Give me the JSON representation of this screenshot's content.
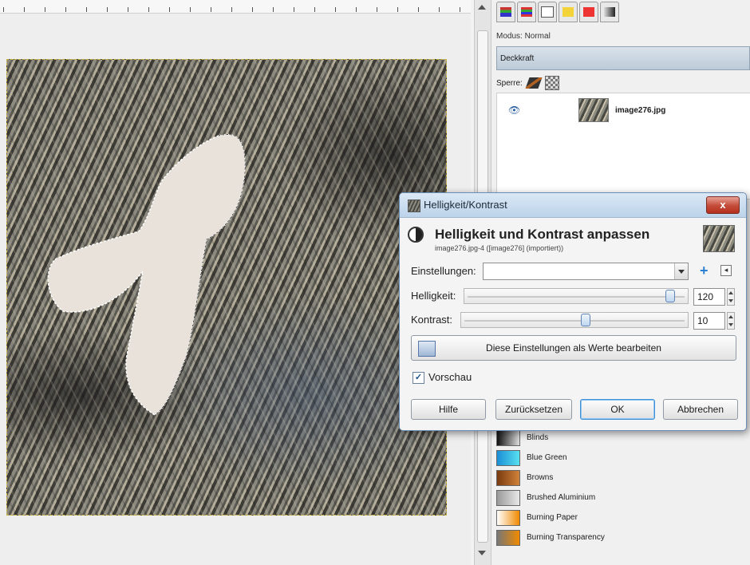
{
  "layers_panel": {
    "mode_label": "Modus: Normal",
    "opacity_label": "Deckkraft",
    "lock_label": "Sperre:",
    "layers": [
      {
        "name": "image276.jpg",
        "visible": true
      }
    ]
  },
  "gradients": [
    {
      "name": "Blinds",
      "colors": [
        "#111111",
        "#dddddd"
      ]
    },
    {
      "name": "Blue Green",
      "colors": [
        "#1a8ed6",
        "#58e0f0"
      ]
    },
    {
      "name": "Browns",
      "colors": [
        "#7a3a10",
        "#d1823a"
      ]
    },
    {
      "name": "Brushed Aluminium",
      "colors": [
        "#9a9a9a",
        "#e8e8e8"
      ]
    },
    {
      "name": "Burning Paper",
      "colors": [
        "#ffffff",
        "#f08a00"
      ]
    },
    {
      "name": "Burning Transparency",
      "colors": [
        "#777777",
        "#f08a00"
      ]
    }
  ],
  "dialog": {
    "window_title": "Helligkeit/Kontrast",
    "close_symbol": "x",
    "heading": "Helligkeit und Kontrast anpassen",
    "subheading": "image276.jpg-4 ([image276] (importiert))",
    "settings": {
      "label": "Einstellungen:",
      "value": "",
      "add_symbol": "+",
      "menu_symbol": "◂"
    },
    "brightness": {
      "label": "Helligkeit:",
      "value": "120",
      "fraction": 0.92
    },
    "contrast": {
      "label": "Kontrast:",
      "value": "10",
      "fraction": 0.55
    },
    "edit_as_values_label": "Diese Einstellungen als Werte bearbeiten",
    "preview": {
      "label": "Vorschau",
      "checked": true,
      "check_symbol": "✓"
    },
    "buttons": {
      "help": "Hilfe",
      "reset": "Zurücksetzen",
      "ok": "OK",
      "cancel": "Abbrechen"
    }
  },
  "colors": {
    "selection_marquee": "#ffffff",
    "accent_blue": "#3d8fd6",
    "close_red": "#c44a38"
  }
}
